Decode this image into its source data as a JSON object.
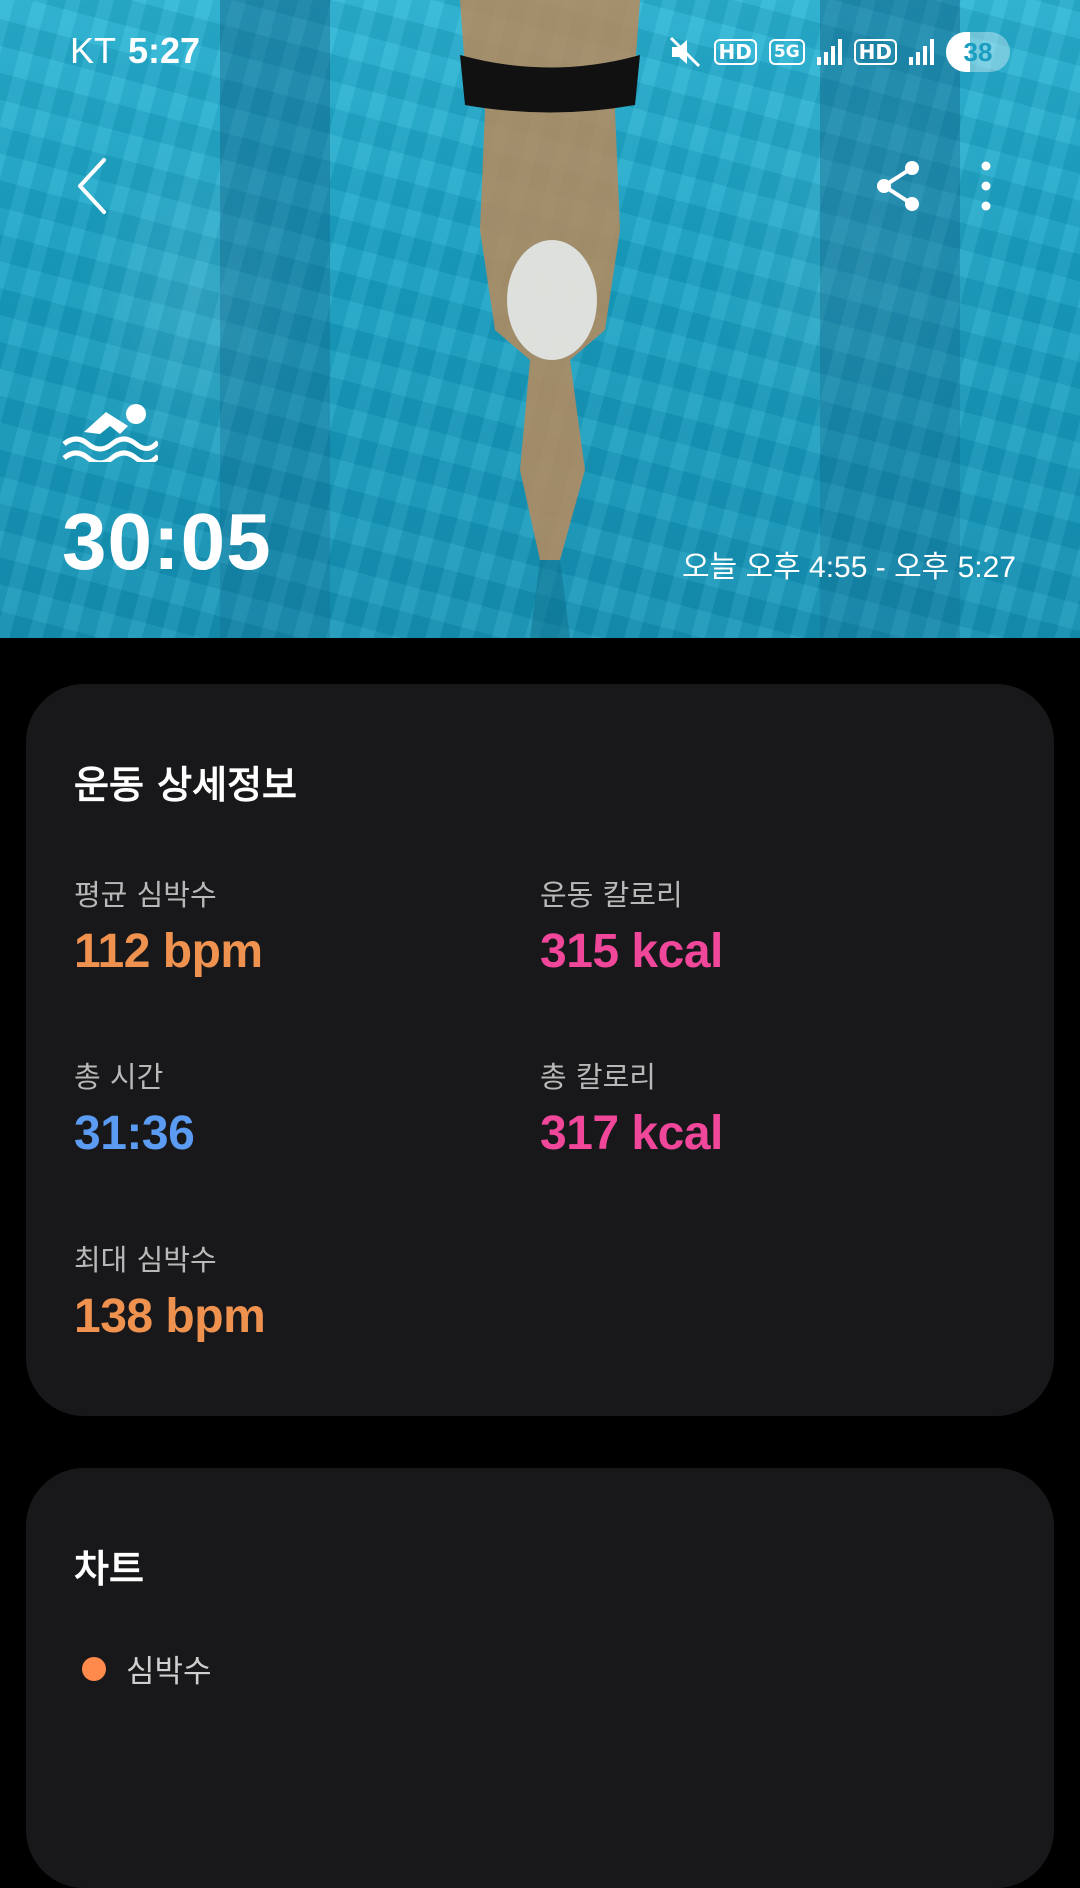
{
  "status_bar": {
    "carrier": "KT",
    "time": "5:27",
    "hd_label": "HD",
    "network_label": "5G",
    "battery_level": "38"
  },
  "hero": {
    "activity_icon": "swimming-icon",
    "duration": "30:05",
    "time_range": "오늘 오후 4:55 - 오후 5:27",
    "icons": {
      "back": "chevron-left-icon",
      "share": "share-icon",
      "more": "more-vert-icon"
    }
  },
  "details": {
    "title": "운동 상세정보",
    "metrics": [
      {
        "label": "평균 심박수",
        "value": "112 bpm",
        "color": "#f0924f"
      },
      {
        "label": "운동 칼로리",
        "value": "315 kcal",
        "color": "#f0479a"
      },
      {
        "label": "총 시간",
        "value": "31:36",
        "color": "#5b9bf2"
      },
      {
        "label": "총 칼로리",
        "value": "317 kcal",
        "color": "#f0479a"
      },
      {
        "label": "최대 심박수",
        "value": "138 bpm",
        "color": "#f0924f"
      }
    ]
  },
  "chart": {
    "title": "차트",
    "legend_label": "심박수",
    "legend_color": "#ff8a4c"
  }
}
